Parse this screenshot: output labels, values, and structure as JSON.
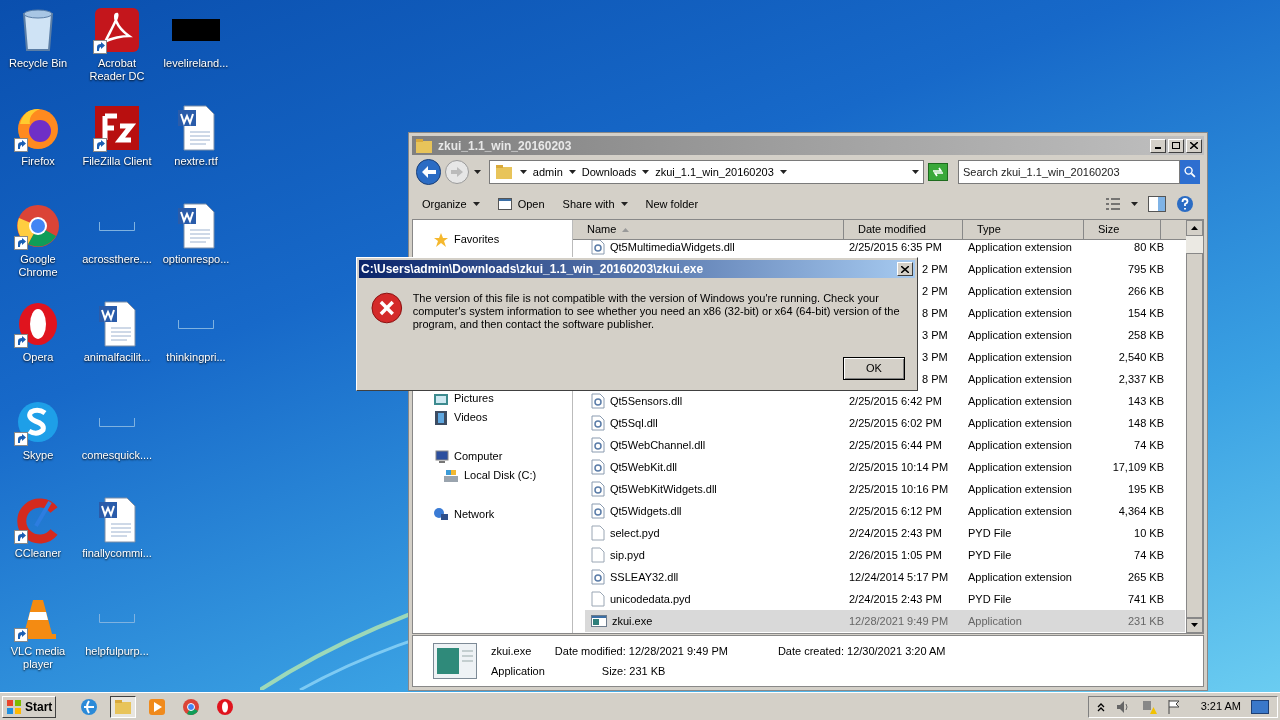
{
  "desktop": {
    "columns": [
      [
        {
          "label": "Recycle Bin",
          "kind": "recycle",
          "shortcut": false
        },
        {
          "label": "Firefox",
          "kind": "firefox",
          "shortcut": true
        },
        {
          "label": "Google Chrome",
          "kind": "chrome",
          "shortcut": true
        },
        {
          "label": "Opera",
          "kind": "opera",
          "shortcut": true
        },
        {
          "label": "Skype",
          "kind": "skype",
          "shortcut": true
        },
        {
          "label": "CCleaner",
          "kind": "ccleaner",
          "shortcut": true
        },
        {
          "label": "VLC media player",
          "kind": "vlc",
          "shortcut": true
        }
      ],
      [
        {
          "label": "Acrobat Reader DC",
          "kind": "acrobat",
          "shortcut": true
        },
        {
          "label": "FileZilla Client",
          "kind": "filezilla",
          "shortcut": true
        },
        {
          "label": "acrossthere....",
          "kind": "blank",
          "shortcut": false
        },
        {
          "label": "animalfacilit...",
          "kind": "word",
          "shortcut": false
        },
        {
          "label": "comesquick....",
          "kind": "blank",
          "shortcut": false
        },
        {
          "label": "finallycommi...",
          "kind": "word",
          "shortcut": false
        },
        {
          "label": "helpfulpurp...",
          "kind": "blank",
          "shortcut": false
        }
      ],
      [
        {
          "label": "levelireland...",
          "kind": "black",
          "shortcut": false
        },
        {
          "label": "nextre.rtf",
          "kind": "word",
          "shortcut": false
        },
        {
          "label": "optionrespo...",
          "kind": "word",
          "shortcut": false
        },
        {
          "label": "thinkingpri...",
          "kind": "blank",
          "shortcut": false
        }
      ]
    ]
  },
  "explorer": {
    "title": "zkui_1.1_win_20160203",
    "breadcrumb": [
      "admin",
      "Downloads",
      "zkui_1.1_win_20160203"
    ],
    "search": {
      "placeholder": "Search zkui_1.1_win_20160203"
    },
    "toolbar": [
      {
        "label": "Organize",
        "kind": "dropdown"
      },
      {
        "label": "Open",
        "kind": "open"
      },
      {
        "label": "Share with",
        "kind": "dropdown"
      },
      {
        "label": "New folder",
        "kind": "plain"
      }
    ],
    "nav_groups": [
      [
        {
          "label": "Favorites",
          "kind": "star"
        }
      ],
      [
        {
          "label": "Pictures",
          "kind": "pictures"
        },
        {
          "label": "Videos",
          "kind": "videos"
        }
      ],
      [
        {
          "label": "Computer",
          "kind": "computer",
          "children": [
            {
              "label": "Local Disk (C:)",
              "kind": "disk"
            }
          ]
        }
      ],
      [
        {
          "label": "Network",
          "kind": "network"
        }
      ]
    ],
    "columns": [
      {
        "label": "Name",
        "sorted": true
      },
      {
        "label": "Date modified",
        "sorted": false
      },
      {
        "label": "Type",
        "sorted": false
      },
      {
        "label": "Size",
        "sorted": false
      }
    ],
    "rows": [
      {
        "kind": "dll",
        "name": "Qt5MultimediaWidgets.dll",
        "date": "2/25/2015 6:35 PM",
        "type": "Application extension",
        "size": "80 KB",
        "selected": false
      },
      {
        "date": "2 PM",
        "type": "Application extension",
        "size": "795 KB",
        "selected": false
      },
      {
        "date": "2 PM",
        "type": "Application extension",
        "size": "266 KB",
        "selected": false
      },
      {
        "date": "8 PM",
        "type": "Application extension",
        "size": "154 KB",
        "selected": false
      },
      {
        "date": "3 PM",
        "type": "Application extension",
        "size": "258 KB",
        "selected": false
      },
      {
        "date": "3 PM",
        "type": "Application extension",
        "size": "2,540 KB",
        "selected": false
      },
      {
        "date": "8 PM",
        "type": "Application extension",
        "size": "2,337 KB",
        "selected": false
      },
      {
        "kind": "dll",
        "name": "Qt5Sensors.dll",
        "date": "2/25/2015 6:42 PM",
        "type": "Application extension",
        "size": "143 KB",
        "selected": false
      },
      {
        "kind": "dll",
        "name": "Qt5Sql.dll",
        "date": "2/25/2015 6:02 PM",
        "type": "Application extension",
        "size": "148 KB",
        "selected": false
      },
      {
        "kind": "dll",
        "name": "Qt5WebChannel.dll",
        "date": "2/25/2015 6:44 PM",
        "type": "Application extension",
        "size": "74 KB",
        "selected": false
      },
      {
        "kind": "dll",
        "name": "Qt5WebKit.dll",
        "date": "2/25/2015 10:14 PM",
        "type": "Application extension",
        "size": "17,109 KB",
        "selected": false
      },
      {
        "kind": "dll",
        "name": "Qt5WebKitWidgets.dll",
        "date": "2/25/2015 10:16 PM",
        "type": "Application extension",
        "size": "195 KB",
        "selected": false
      },
      {
        "kind": "dll",
        "name": "Qt5Widgets.dll",
        "date": "2/25/2015 6:12 PM",
        "type": "Application extension",
        "size": "4,364 KB",
        "selected": false
      },
      {
        "kind": "file",
        "name": "select.pyd",
        "date": "2/24/2015 2:43 PM",
        "type": "PYD File",
        "size": "10 KB",
        "selected": false
      },
      {
        "kind": "file",
        "name": "sip.pyd",
        "date": "2/26/2015 1:05 PM",
        "type": "PYD File",
        "size": "74 KB",
        "selected": false
      },
      {
        "kind": "dll",
        "name": "SSLEAY32.dll",
        "date": "12/24/2014 5:17 PM",
        "type": "Application extension",
        "size": "265 KB",
        "selected": false
      },
      {
        "kind": "file",
        "name": "unicodedata.pyd",
        "date": "2/24/2015 2:43 PM",
        "type": "PYD File",
        "size": "741 KB",
        "selected": false
      },
      {
        "kind": "exe",
        "name": "zkui.exe",
        "date": "12/28/2021 9:49 PM",
        "type": "Application",
        "size": "231 KB",
        "selected": true
      }
    ],
    "details": {
      "name": "zkui.exe",
      "type": "Application",
      "modified_label": "Date modified:",
      "modified": "12/28/2021 9:49 PM",
      "size_label": "Size:",
      "size": "231 KB",
      "created_label": "Date created:",
      "created": "12/30/2021 3:20 AM"
    }
  },
  "dialog": {
    "title": "C:\\Users\\admin\\Downloads\\zkui_1.1_win_20160203\\zkui.exe",
    "message": "The version of this file is not compatible with the version of Windows you're running. Check your computer's system information to see whether you need an x86 (32-bit) or x64 (64-bit) version of the program, and then contact the software publisher.",
    "button": "OK"
  },
  "taskbar": {
    "start": "Start",
    "apps": [
      {
        "kind": "ie",
        "active": false
      },
      {
        "kind": "explorer",
        "active": true
      },
      {
        "kind": "media",
        "active": false
      },
      {
        "kind": "chrome",
        "active": false
      },
      {
        "kind": "opera",
        "active": false
      }
    ],
    "clock": "3:21 AM"
  }
}
